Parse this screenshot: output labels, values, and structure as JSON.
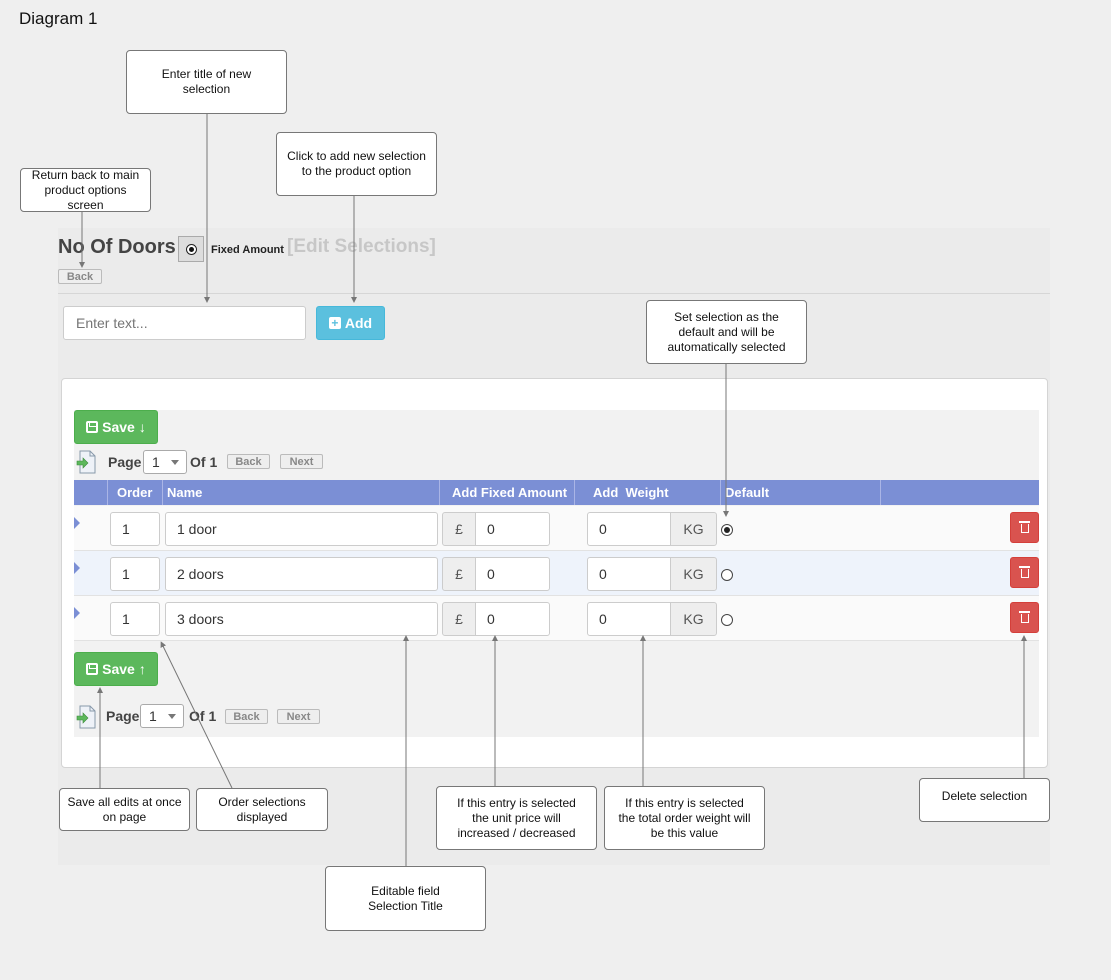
{
  "diagram_title": "Diagram 1",
  "header": {
    "title": "No Of Doors",
    "fixed_amount_label": "Fixed Amount",
    "edit_selections": "[Edit Selections]",
    "back_label": "Back"
  },
  "new_selection": {
    "placeholder": "Enter text...",
    "add_label": "Add"
  },
  "grid": {
    "save_label": "Save",
    "pager": {
      "page_label": "Page",
      "page_value": "1",
      "of_label": "Of 1",
      "back_label": "Back",
      "next_label": "Next"
    },
    "columns": [
      "Order",
      "Name",
      "Add Fixed Amount",
      "Add  Weight",
      "Default"
    ],
    "currency_symbol": "£",
    "weight_unit": "KG",
    "rows": [
      {
        "order": "1",
        "name": "1 door",
        "amount": "0",
        "weight": "0",
        "default": true
      },
      {
        "order": "1",
        "name": "2 doors",
        "amount": "0",
        "weight": "0",
        "default": false
      },
      {
        "order": "1",
        "name": "3 doors",
        "amount": "0",
        "weight": "0",
        "default": false
      }
    ]
  },
  "callouts": {
    "enter_title": "Enter title of new\nselection",
    "add_new": "Click to add new selection\nto the product option",
    "return_back": "Return back to main\nproduct options screen",
    "set_default": "Set selection as the\ndefault and will be\nautomatically selected",
    "save_all": "Save all edits at once\non page",
    "order_selections": "Order selections\ndisplayed",
    "unit_price": "If this entry is selected\nthe unit price will\nincreased / decreased",
    "order_weight": "If this entry is selected\nthe total order weight will\nbe this value",
    "delete_selection": "Delete selection",
    "editable_field": "Editable field\nSelection Title"
  },
  "colors": {
    "header_bar": "#7b8fd5",
    "save_green": "#5cb85c",
    "add_blue": "#5bc0de",
    "delete_red": "#d9534f"
  }
}
